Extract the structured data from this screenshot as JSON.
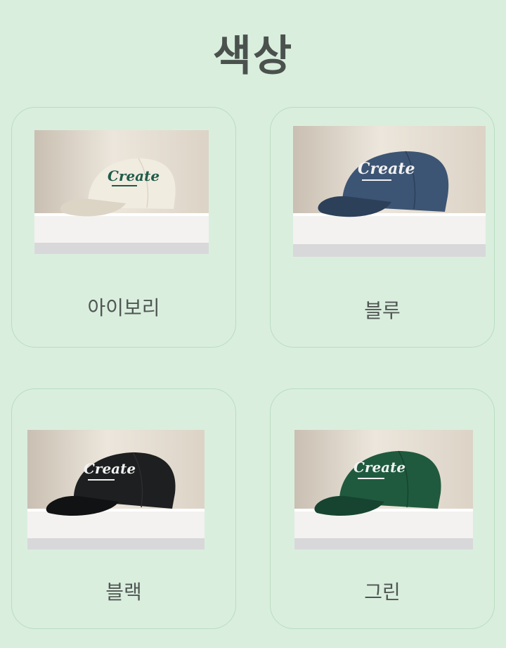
{
  "title": "색상",
  "options": [
    {
      "label": "아이보리",
      "cap_color": "#f1ece0",
      "cap_shade": "#dcd5c6",
      "logo_text": "Create",
      "logo_color": "#1f5c4a"
    },
    {
      "label": "블루",
      "cap_color": "#3d5574",
      "cap_shade": "#2c4059",
      "logo_text": "Create",
      "logo_color": "#f2f2f2"
    },
    {
      "label": "블랙",
      "cap_color": "#1d1f20",
      "cap_shade": "#111213",
      "logo_text": "Create",
      "logo_color": "#f2f2f2"
    },
    {
      "label": "그린",
      "cap_color": "#1f5a3e",
      "cap_shade": "#164430",
      "logo_text": "Create",
      "logo_color": "#f2f2f2"
    }
  ]
}
